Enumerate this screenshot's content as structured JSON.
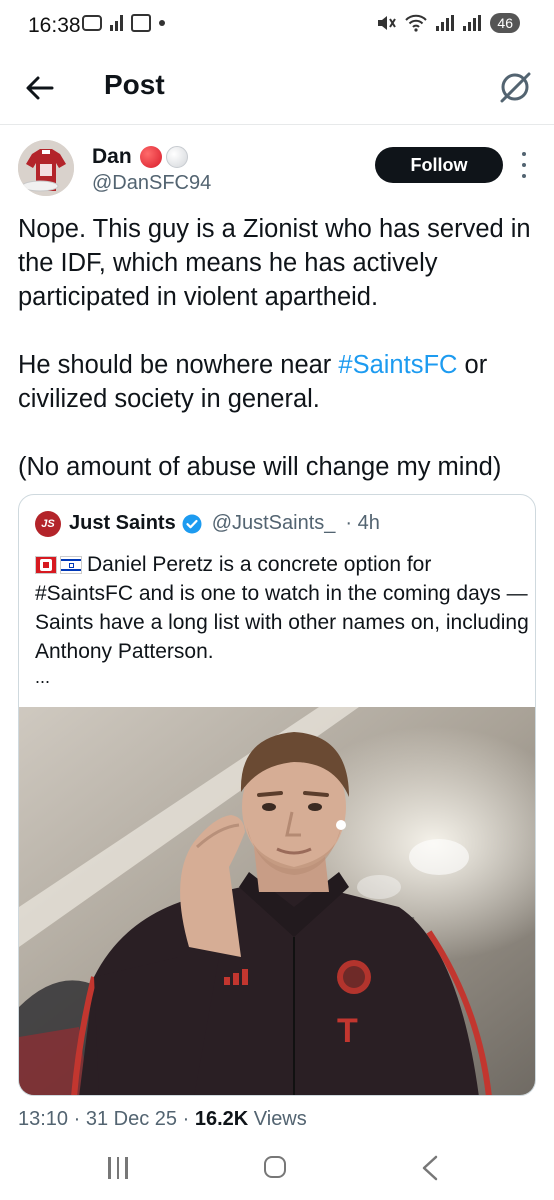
{
  "status_bar": {
    "time": "16:38",
    "battery": "46"
  },
  "header": {
    "title": "Post"
  },
  "author": {
    "name": "Dan",
    "handle": "@DanSFC94",
    "follow_label": "Follow"
  },
  "post": {
    "paragraphs": [
      "Nope. This guy is a Zionist who has served in the IDF, which means he has actively participated in violent apartheid.",
      "He should be nowhere near",
      "or civilized society in general.",
      "(No amount of abuse will change my mind)"
    ],
    "hashtag": "#SaintsFC"
  },
  "quote": {
    "avatar_text": "JS",
    "name": "Just Saints",
    "handle": "@JustSaints_",
    "time": "· 4h",
    "text": "Daniel Peretz is a concrete option for #SaintsFC and is one to watch in the coming days — Saints have a long list with other names on, including Anthony Patterson.",
    "ellipsis": "...",
    "photo_icon": "bayern-munich-crest-icon"
  },
  "meta": {
    "time": "13:10",
    "date": "31 Dec 25",
    "views_count": "16.2K",
    "views_label": "Views"
  },
  "colors": {
    "link": "#1d9bf0",
    "secondary_text": "#536471",
    "follow_bg": "#0f1419",
    "jersey_red": "#b3242a"
  }
}
